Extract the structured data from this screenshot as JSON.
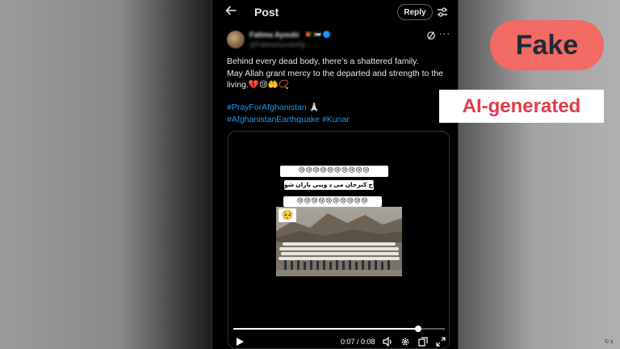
{
  "header": {
    "back_icon": "arrow-left-icon",
    "title": "Post",
    "reply_label": "Reply",
    "settings_icon": "sliders-icon"
  },
  "author": {
    "name": "Fatima Ayoubi",
    "handle": "@FatimaAyoubiAfg",
    "badges": "🇦🇫 🇵🇸"
  },
  "post": {
    "line1": "Behind every dead body, there’s a shattered family.",
    "line2": "May Allah grant mercy to the departed and strength to the",
    "line3": "living.💔😢🤲📿",
    "hashtag1": "#PrayForAfghanistan",
    "hashtag1_emoji": "🙏🏻",
    "hashtag2": "#AfghanistanEarthquake",
    "hashtag3": "#Kunar"
  },
  "video": {
    "emoji_row_1": "😢😢😢😢😢😢😢😢😢😢",
    "caption": "اخ اخ کنرجان می د وینی باران شو",
    "emoji_row_2": "😢😢😢😢😢😢😢😢😢😢",
    "emoji_single": "🥺",
    "time": "0:07 / 0:08",
    "progress": 0.875
  },
  "labels": {
    "fake": "Fake",
    "ai": "AI-generated"
  },
  "credit": "© x",
  "colors": {
    "accent_blue": "#1d9bf0",
    "fake_bg": "#f26a62",
    "ai_text": "#e03c4a"
  }
}
